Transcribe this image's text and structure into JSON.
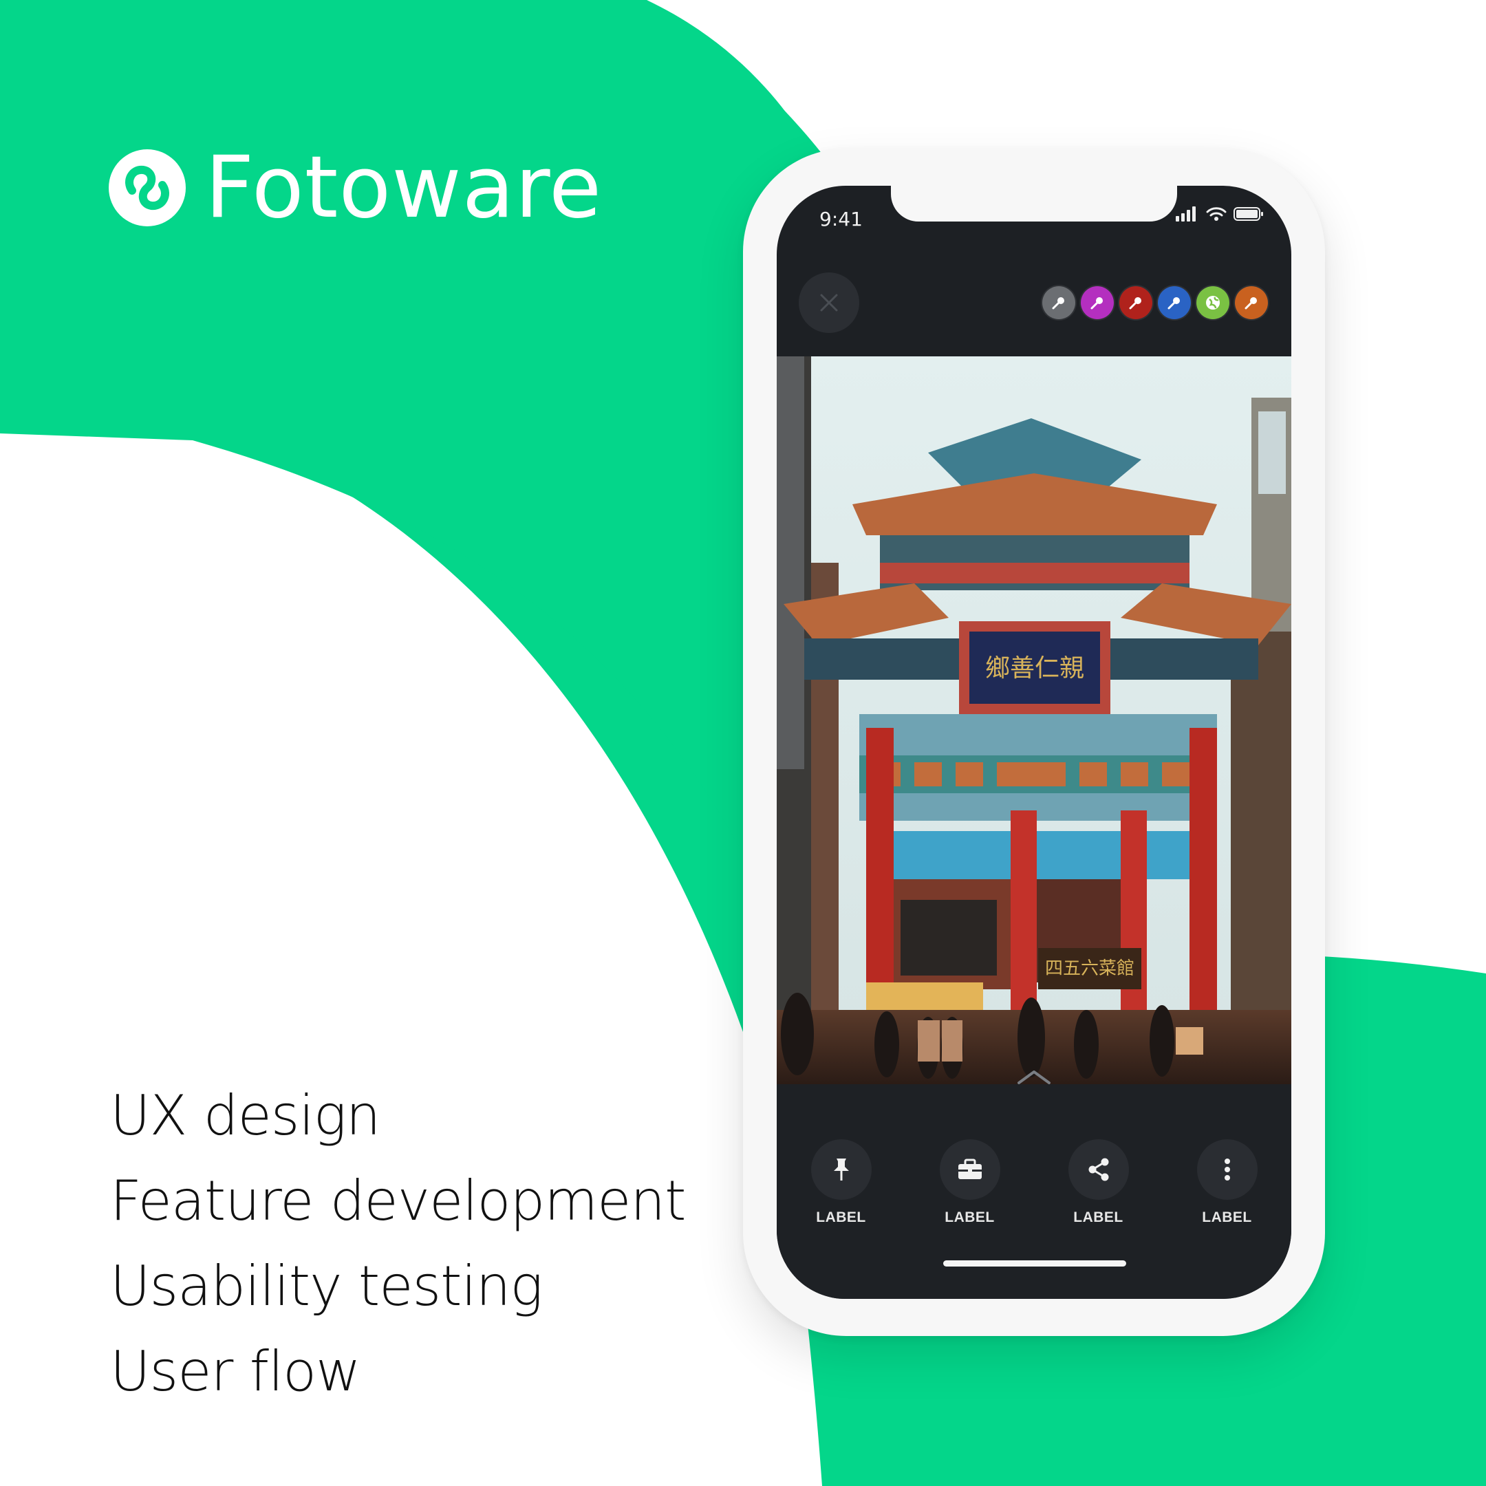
{
  "brand": {
    "name": "Fotoware",
    "logo_icon": "fotoware-logo-icon",
    "color": "#ffffff"
  },
  "colors": {
    "accent": "#04d68a",
    "background": "#ffffff",
    "text": "#111111"
  },
  "features": [
    {
      "label": "UX design"
    },
    {
      "label": "Feature development"
    },
    {
      "label": "Usability testing"
    },
    {
      "label": "User flow"
    }
  ],
  "phone": {
    "status_bar": {
      "time": "9:41",
      "icons": [
        "signal-icon",
        "wifi-icon",
        "battery-icon"
      ]
    },
    "top_bar": {
      "close_icon": "close-icon",
      "access_indicators": [
        {
          "icon": "key-icon",
          "color": "#6b6e72"
        },
        {
          "icon": "key-icon",
          "color": "#b42fbf"
        },
        {
          "icon": "key-icon",
          "color": "#b0221c"
        },
        {
          "icon": "key-icon",
          "color": "#2a63c4"
        },
        {
          "icon": "globe-icon",
          "color": "#7ac143"
        },
        {
          "icon": "key-icon",
          "color": "#c9611f"
        }
      ]
    },
    "photo": {
      "subject": "chinatown-gate-photo"
    },
    "expand_icon": "chevron-up-icon",
    "actions": [
      {
        "icon": "pin-icon",
        "label": "LABEL"
      },
      {
        "icon": "briefcase-icon",
        "label": "LABEL"
      },
      {
        "icon": "share-icon",
        "label": "LABEL"
      },
      {
        "icon": "more-vertical-icon",
        "label": "LABEL"
      }
    ]
  }
}
